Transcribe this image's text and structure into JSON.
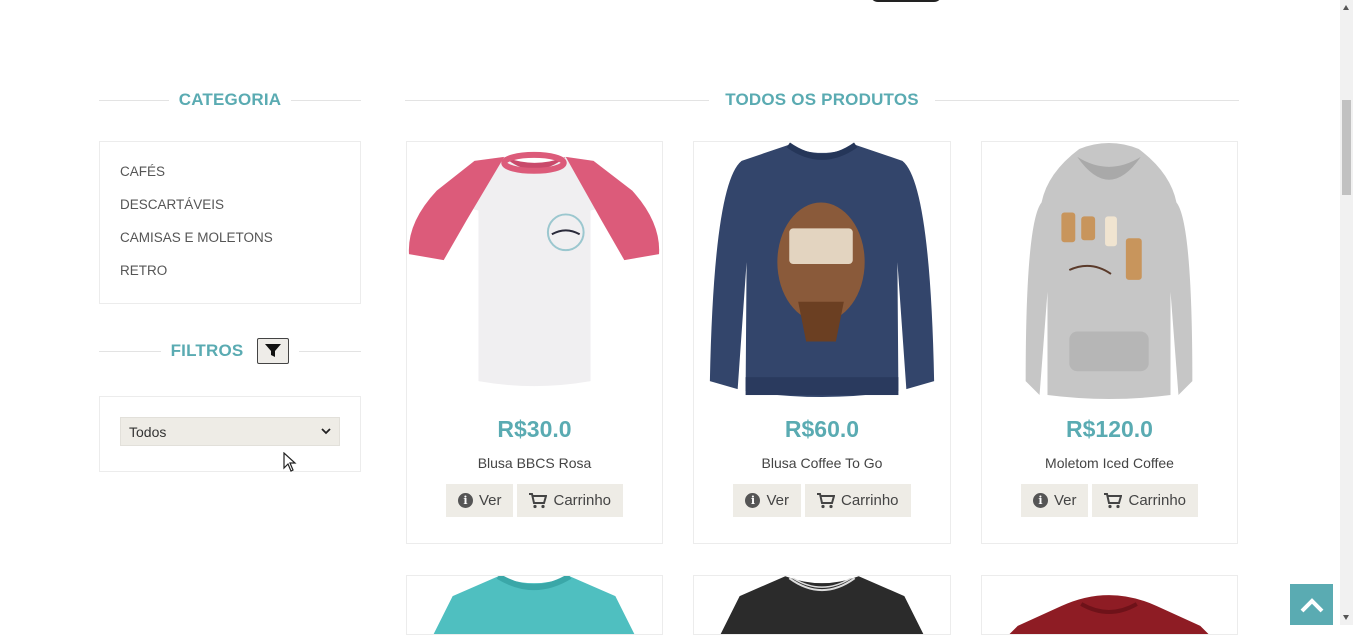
{
  "category": {
    "title": "CATEGORIA",
    "items": [
      "CAFÉS",
      "DESCARTÁVEIS",
      "CAMISAS E MOLETONS",
      "RETRO"
    ]
  },
  "filters": {
    "title": "FILTROS",
    "select_value": "Todos"
  },
  "products": {
    "title": "TODOS OS PRODUTOS",
    "view_label": "Ver",
    "cart_label": "Carrinho",
    "items": [
      {
        "price": "R$30.0",
        "name": "Blusa BBCS Rosa"
      },
      {
        "price": "R$60.0",
        "name": "Blusa Coffee To Go"
      },
      {
        "price": "R$120.0",
        "name": "Moletom Iced Coffee"
      }
    ]
  },
  "colors": {
    "accent": "#5aabb2",
    "button_bg": "#eeece6"
  }
}
